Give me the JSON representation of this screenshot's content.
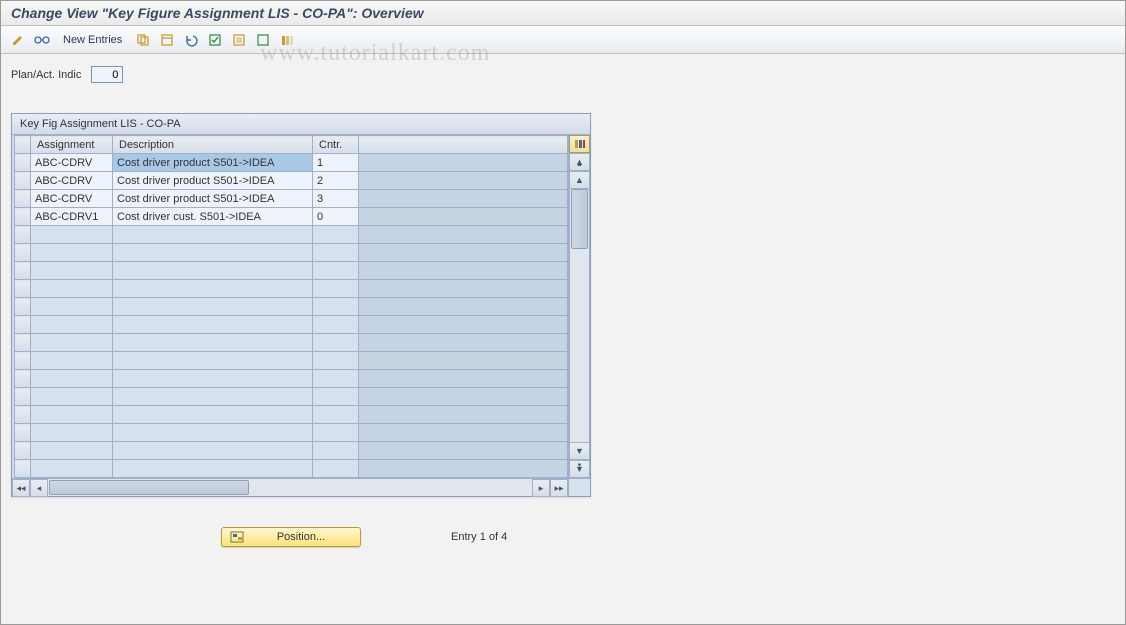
{
  "title": "Change View \"Key Figure Assignment LIS - CO-PA\": Overview",
  "toolbar": {
    "new_entries_label": "New Entries"
  },
  "fields": {
    "plan_act_label": "Plan/Act. Indic",
    "plan_act_value": "0"
  },
  "grid": {
    "title": "Key Fig Assignment LIS - CO-PA",
    "headers": {
      "assignment": "Assignment",
      "description": "Description",
      "cntr": "Cntr."
    },
    "rows": [
      {
        "assignment": "ABC-CDRV",
        "description": "Cost driver product S501->IDEA",
        "cntr": "1",
        "selected": true
      },
      {
        "assignment": "ABC-CDRV",
        "description": "Cost driver product S501->IDEA",
        "cntr": "2",
        "selected": false
      },
      {
        "assignment": "ABC-CDRV",
        "description": "Cost driver product S501->IDEA",
        "cntr": "3",
        "selected": false
      },
      {
        "assignment": "ABC-CDRV1",
        "description": "Cost driver cust. S501->IDEA",
        "cntr": "0",
        "selected": false
      }
    ],
    "empty_rows": 14
  },
  "footer": {
    "position_label": "Position...",
    "entry_text": "Entry 1 of 4"
  },
  "watermark": "www.tutorialkart.com"
}
